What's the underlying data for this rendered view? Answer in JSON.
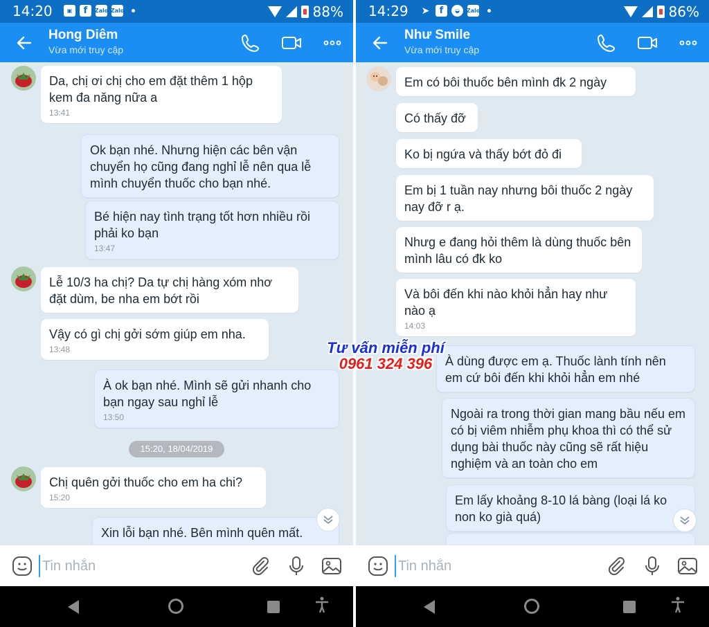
{
  "left": {
    "status": {
      "time": "14:20",
      "battery": "88%",
      "icons": [
        "gallery-icon",
        "facebook-icon",
        "zalo-icon",
        "zalo-icon"
      ],
      "zalo_label": "Zalo"
    },
    "header": {
      "name": "Hong Diêm",
      "status": "Vừa mới truy cập"
    },
    "messages": [
      {
        "dir": "in",
        "text": "Da, chị ơi chị cho em đặt thêm 1 hộp kem đa năng nữa a",
        "time": "13:41"
      },
      {
        "dir": "out",
        "text": "Ok bạn nhé. Nhưng hiện các bên vận chuyển họ cũng đang nghỉ lễ nên qua lễ mình chuyển thuốc cho bạn nhé.",
        "time": ""
      },
      {
        "dir": "out",
        "text": "Bé hiện nay tình trạng tốt hơn nhiều rồi phải ko bạn",
        "time": "13:47"
      },
      {
        "dir": "in",
        "text": "Lễ 10/3 ha chị? Da tự chị hàng xóm nhơ đặt dùm, be nha em bớt rồi",
        "time": ""
      },
      {
        "dir": "in",
        "text": "Vậy có gì chị gởi sớm giúp em nha.",
        "time": "13:48"
      },
      {
        "dir": "out",
        "text": "À ok bạn nhé. Mình sẽ gửi nhanh cho bạn ngay sau nghỉ lễ",
        "time": "13:50"
      },
      {
        "dir": "in",
        "text": "Chị quên gởi thuốc cho em ha chi?",
        "time": "15:20"
      },
      {
        "dir": "out",
        "text": "Xin lỗi bạn nhé. Bên mình quên mất.",
        "time": ""
      }
    ],
    "date_separator": "15:20, 18/04/2019",
    "input_placeholder": "Tin nhắn"
  },
  "right": {
    "status": {
      "time": "14:29",
      "battery": "86%",
      "icons": [
        "telegram-icon",
        "facebook-icon",
        "messenger-icon",
        "zalo-icon"
      ],
      "zalo_label": "Zalo"
    },
    "header": {
      "name": "Như Smile",
      "status": "Vừa mới truy cập"
    },
    "messages": [
      {
        "dir": "in",
        "text": "Em có bôi thuốc bên mình đk 2 ngày",
        "time": ""
      },
      {
        "dir": "in",
        "text": "Có thấy đỡ",
        "time": ""
      },
      {
        "dir": "in",
        "text": "Ko bị ngứa và thấy bớt đỏ đi",
        "time": ""
      },
      {
        "dir": "in",
        "text": "Em bị 1 tuần nay nhưng bôi thuốc 2 ngày nay đỡ r ạ.",
        "time": ""
      },
      {
        "dir": "in",
        "text": "Nhưg e đang hỏi thêm là dùng  thuốc bên mình lâu có đk ko",
        "time": ""
      },
      {
        "dir": "in",
        "text": "Và bôi đến khi nào khỏi hẳn hay như nào ạ",
        "time": "14:03"
      },
      {
        "dir": "out",
        "text": "À dùng được em ạ. Thuốc lành tính nên em cứ bôi đến khi khỏi hẳn em nhé",
        "time": ""
      },
      {
        "dir": "out",
        "text": "Ngoài ra trong thời gian mang bầu nếu em có bị viêm nhiễm phụ khoa thì có thể sử dụng bài thuốc này cũng sẽ rất hiệu nghiệm và an toàn cho em",
        "time": ""
      },
      {
        "dir": "out",
        "text": "Em lấy khoảng 8-10 lá bàng (loại lá ko non ko già quá)",
        "time": ""
      }
    ],
    "input_placeholder": "Tin nhắn"
  },
  "promo": {
    "line1": "Tư vấn miễn phí",
    "line2": "0961 324 396"
  },
  "colors": {
    "header": "#1a8ef2",
    "statusbar": "#0d6fc3",
    "chat_bg": "#dfe9f1",
    "bubble_in": "#ffffff",
    "bubble_out": "#e3effd",
    "promo_blue": "#1730d8",
    "promo_red": "#e2201b"
  }
}
